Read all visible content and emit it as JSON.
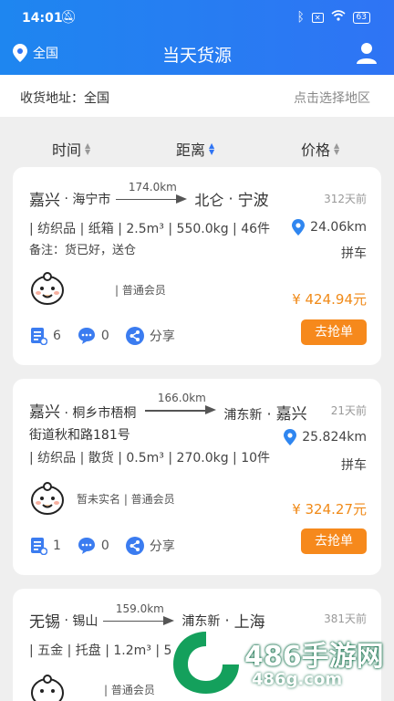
{
  "status_bar": {
    "time": "14:01",
    "battery": "63"
  },
  "header": {
    "location": "全国",
    "title": "当天货源"
  },
  "address_bar": {
    "label": "收货地址：全国",
    "select_hint": "点击选择地区"
  },
  "sort_options": [
    {
      "label": "时间",
      "active": false
    },
    {
      "label": "距离",
      "active": true
    },
    {
      "label": "价格",
      "active": false
    }
  ],
  "cards": [
    {
      "from_a": "嘉兴",
      "from_b": "海宁市",
      "distance": "174.0km",
      "to_a": "北仑",
      "to_b": "宁波",
      "time_ago": "312天前",
      "specs": "| 纺织品 | 纸箱 | 2.5m³ | 550.0kg | 46件",
      "note": "备注：货已好，送仓",
      "pickup_distance": "24.06km",
      "load_type": "拼车",
      "member": "| 普通会员",
      "price": "¥ 424.94元",
      "grab_label": "去抢单",
      "count_docs": "6",
      "count_comments": "0",
      "share_label": "分享"
    },
    {
      "from_a": "嘉兴",
      "from_b": "桐乡市梧桐",
      "from_c": "街道秋和路181号",
      "distance": "166.0km",
      "to_a": "浦东新",
      "to_b": "嘉兴",
      "time_ago": "21天前",
      "specs": "| 纺织品 | 散货 | 0.5m³ | 270.0kg | 10件",
      "pickup_distance": "25.824km",
      "load_type": "拼车",
      "member": "暂未实名 | 普通会员",
      "price": "¥ 324.27元",
      "grab_label": "去抢单",
      "count_docs": "1",
      "count_comments": "0",
      "share_label": "分享"
    },
    {
      "from_a": "无锡",
      "from_b": "锡山",
      "distance": "159.0km",
      "to_a": "浦东新",
      "to_b": "上海",
      "time_ago": "381天前",
      "specs": "| 五金 | 托盘 | 1.2m³ | 5",
      "member": "| 普通会员"
    }
  ],
  "watermark": {
    "brand": "486手游网",
    "url": "486g.com"
  },
  "colors": {
    "primary": "#2f74f4",
    "accent": "#f6891c",
    "price": "#f08a18"
  }
}
